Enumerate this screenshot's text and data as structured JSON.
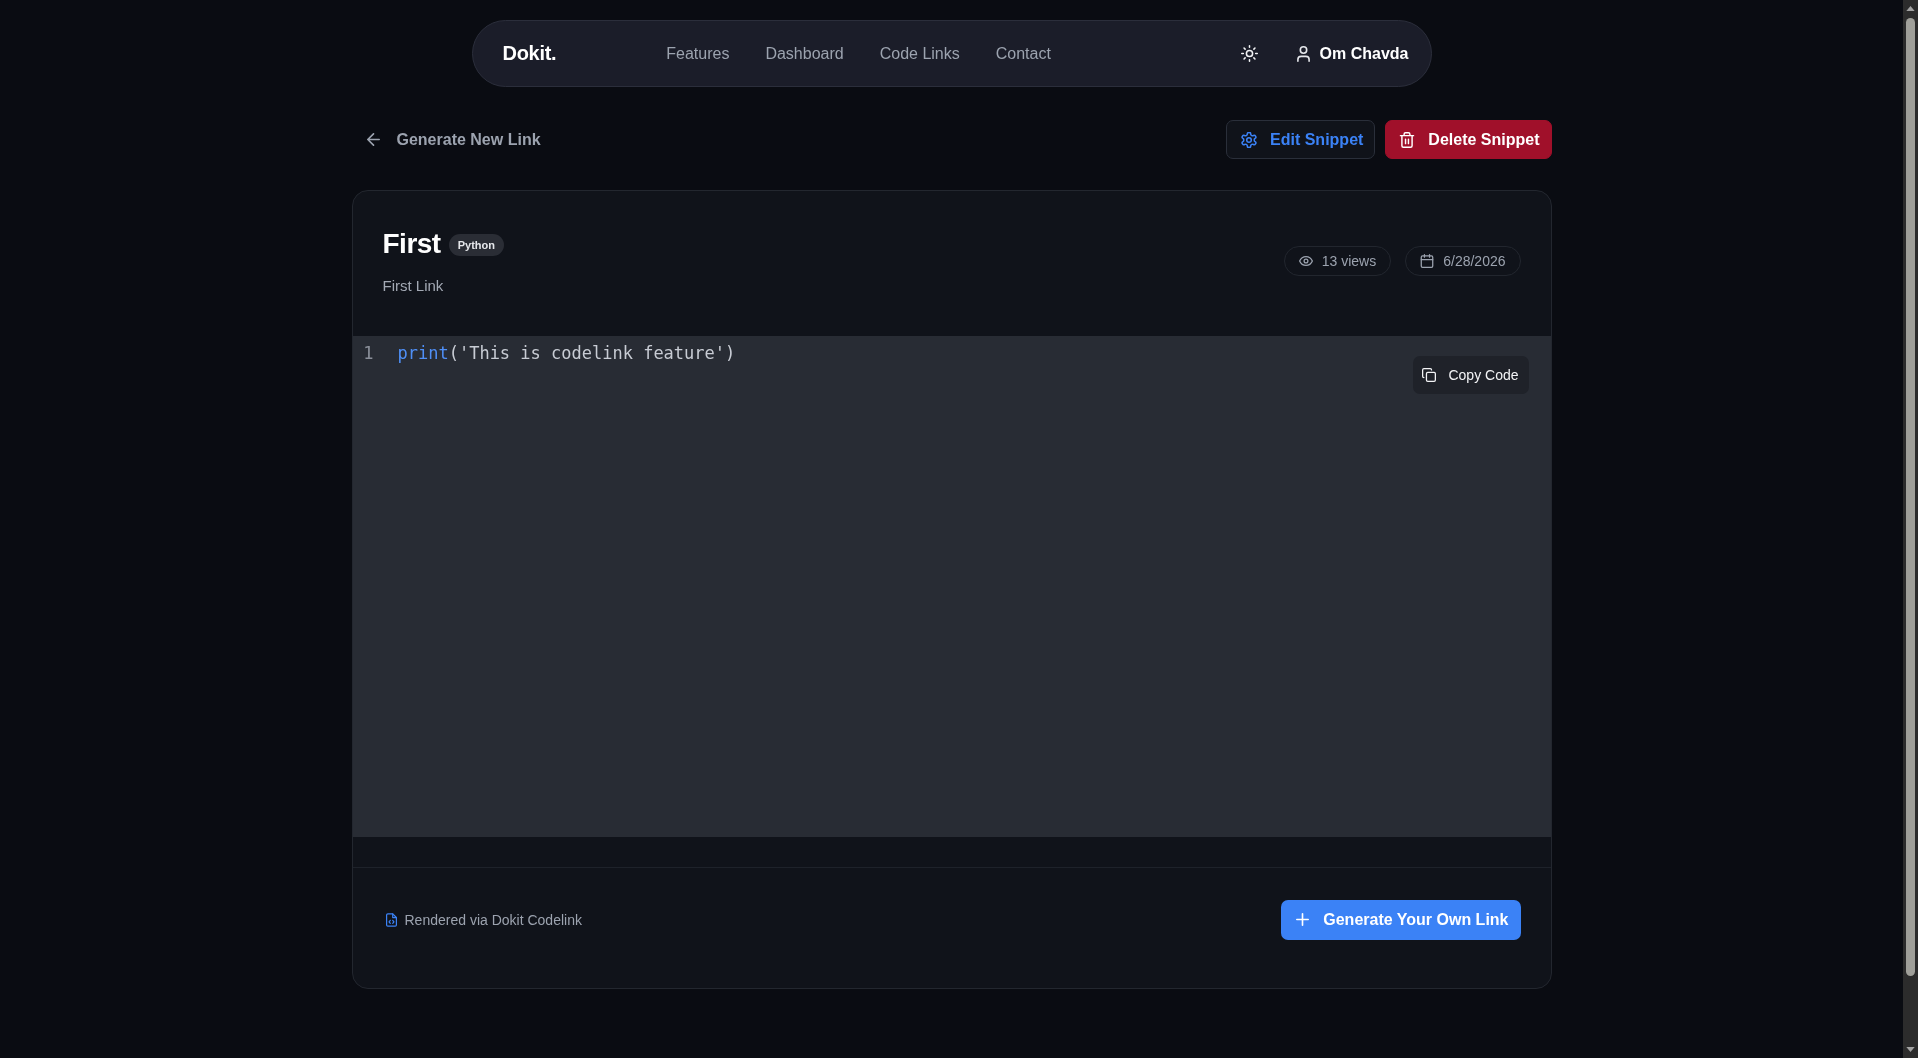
{
  "navbar": {
    "logo": "Dokit.",
    "links": [
      {
        "label": "Features"
      },
      {
        "label": "Dashboard"
      },
      {
        "label": "Code Links"
      },
      {
        "label": "Contact"
      }
    ],
    "user": {
      "name": "Om Chavda"
    }
  },
  "back_link": {
    "label": "Generate New Link"
  },
  "actions": [
    {
      "label": "Edit Snippet",
      "kind": "edit"
    },
    {
      "label": "Delete Snippet",
      "kind": "delete"
    }
  ],
  "snippet": {
    "title": "First",
    "language": "Python",
    "description": "First Link",
    "views": "13 views",
    "date": "6/28/2026"
  },
  "code": {
    "lines": [
      {
        "number": "1",
        "tokens": [
          {
            "text": "print",
            "kind": "function"
          },
          {
            "text": "('This is codelink feature')",
            "kind": "plain"
          }
        ]
      }
    ],
    "copy_button": "Copy Code"
  },
  "footer": {
    "note": "Rendered via Dokit Codelink",
    "button": "Generate Your Own Link"
  }
}
